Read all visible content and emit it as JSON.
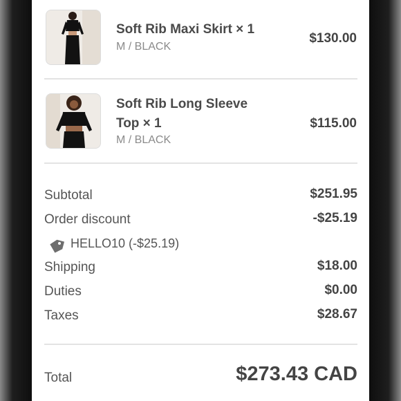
{
  "items": [
    {
      "name": "Soft Rib Maxi Skirt × 1",
      "variant": "M / BLACK",
      "price": "$130.00",
      "thumbnail": "maxi-skirt-photo"
    },
    {
      "name_line1": "Soft Rib Long Sleeve",
      "name_line2": "Top × 1",
      "variant": "M / BLACK",
      "price": "$115.00",
      "thumbnail": "long-sleeve-top-photo"
    }
  ],
  "summary": {
    "subtotal_label": "Subtotal",
    "subtotal_value": "$251.95",
    "discount_label": "Order discount",
    "discount_value": "-$25.19",
    "discount_code": "HELLO10 (-$25.19)",
    "discount_code_icon": "tag-icon",
    "shipping_label": "Shipping",
    "shipping_value": "$18.00",
    "duties_label": "Duties",
    "duties_value": "$0.00",
    "taxes_label": "Taxes",
    "taxes_value": "$28.67"
  },
  "total": {
    "label": "Total",
    "value": "$273.43 CAD"
  },
  "colors": {
    "text_primary": "#444444",
    "text_secondary": "#8a8a8a",
    "divider": "#e3e3e3",
    "frame": "#1c1c1c"
  }
}
